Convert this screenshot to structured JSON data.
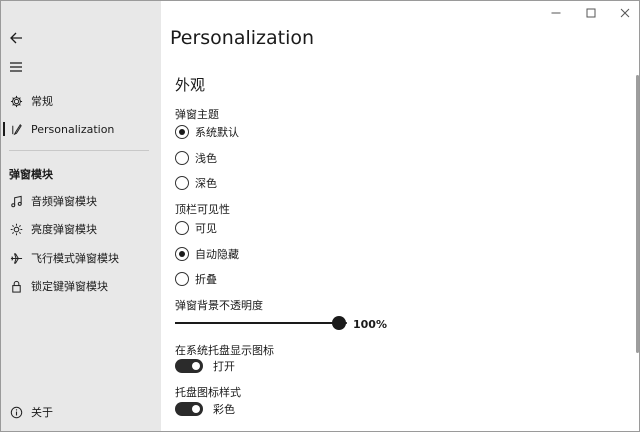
{
  "window_controls": {
    "minimize": "—",
    "maximize": "☐",
    "close": "✕"
  },
  "sidebar": {
    "back_icon": "back-arrow-icon",
    "menu_icon": "hamburger-icon",
    "items": [
      {
        "label": "常规",
        "icon": "gear-icon"
      },
      {
        "label": "Personalization",
        "icon": "brush-icon",
        "selected": true
      }
    ],
    "section_header": "弹窗模块",
    "module_items": [
      {
        "label": "音频弹窗模块",
        "icon": "music-note-icon"
      },
      {
        "label": "亮度弹窗模块",
        "icon": "brightness-icon"
      },
      {
        "label": "飞行模式弹窗模块",
        "icon": "airplane-icon"
      },
      {
        "label": "锁定键弹窗模块",
        "icon": "lock-icon"
      }
    ],
    "about_label": "关于",
    "about_icon": "info-icon"
  },
  "main": {
    "page_title": "Personalization",
    "group_title": "外观",
    "theme": {
      "label": "弹窗主题",
      "options": [
        "系统默认",
        "浅色",
        "深色"
      ],
      "selected": "系统默认"
    },
    "top_bar": {
      "label": "顶栏可见性",
      "options": [
        "可见",
        "自动隐藏",
        "折叠"
      ],
      "selected": "自动隐藏"
    },
    "opacity": {
      "label": "弹窗背景不透明度",
      "value_text": "100%",
      "value": 1.0
    },
    "tray_icon": {
      "label": "在系统托盘显示图标",
      "state_text": "打开",
      "on": true
    },
    "tray_style": {
      "label": "托盘图标样式",
      "state_text": "彩色",
      "on": true
    }
  }
}
